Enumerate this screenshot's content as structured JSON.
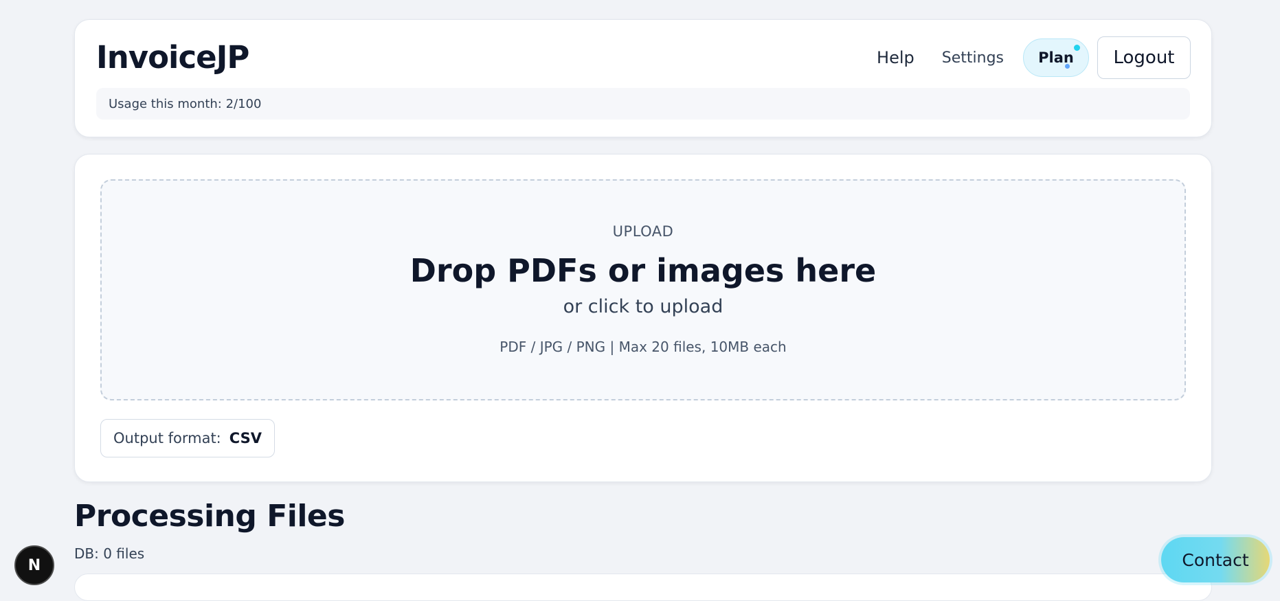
{
  "header": {
    "brand": "InvoiceJP",
    "nav": {
      "help": "Help",
      "settings": "Settings",
      "plan": "Plan",
      "logout": "Logout"
    },
    "usage": "Usage this month: 2/100"
  },
  "upload": {
    "eyebrow": "UPLOAD",
    "title": "Drop PDFs or images here",
    "subtitle": "or click to upload",
    "hint": "PDF / JPG / PNG | Max 20 files, 10MB each",
    "output_format_label": "Output format:",
    "output_format_value": "CSV"
  },
  "processing": {
    "title": "Processing Files",
    "db_count": "DB: 0 files"
  },
  "floating": {
    "badge_letter": "N",
    "contact": "Contact"
  },
  "colors": {
    "background": "#f1f3f7",
    "text_primary": "#0f172a",
    "plan_pill": "#e3f6fd",
    "contact_gradient_start": "#5ed8f2",
    "contact_gradient_end": "#e6d876"
  }
}
